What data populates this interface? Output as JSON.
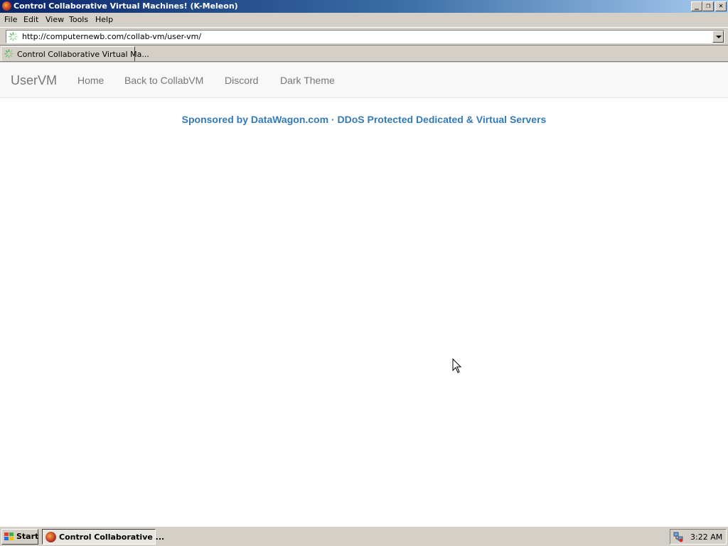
{
  "window": {
    "title": "Control Collaborative Virtual Machines! (K-Meleon)",
    "minimize_label": "_",
    "maximize_label": "❐",
    "close_label": "✕"
  },
  "menu": {
    "items": [
      "File",
      "Edit",
      "View",
      "Tools",
      "Help"
    ]
  },
  "address": {
    "url": "http://computernewb.com/collab-vm/user-vm/"
  },
  "tab": {
    "label": "Control Collaborative Virtual Ma..."
  },
  "page": {
    "brand": "UserVM",
    "nav": [
      "Home",
      "Back to CollabVM",
      "Discord",
      "Dark Theme"
    ],
    "sponsor": "Sponsored by DataWagon.com · DDoS Protected Dedicated & Virtual Servers",
    "colors": {
      "link": "#337ab7",
      "nav_text": "#777777",
      "navbar_bg": "#f8f8f8"
    }
  },
  "taskbar": {
    "start_label": "Start",
    "task_label": "Control Collaborative ...",
    "clock": "3:22 AM"
  }
}
